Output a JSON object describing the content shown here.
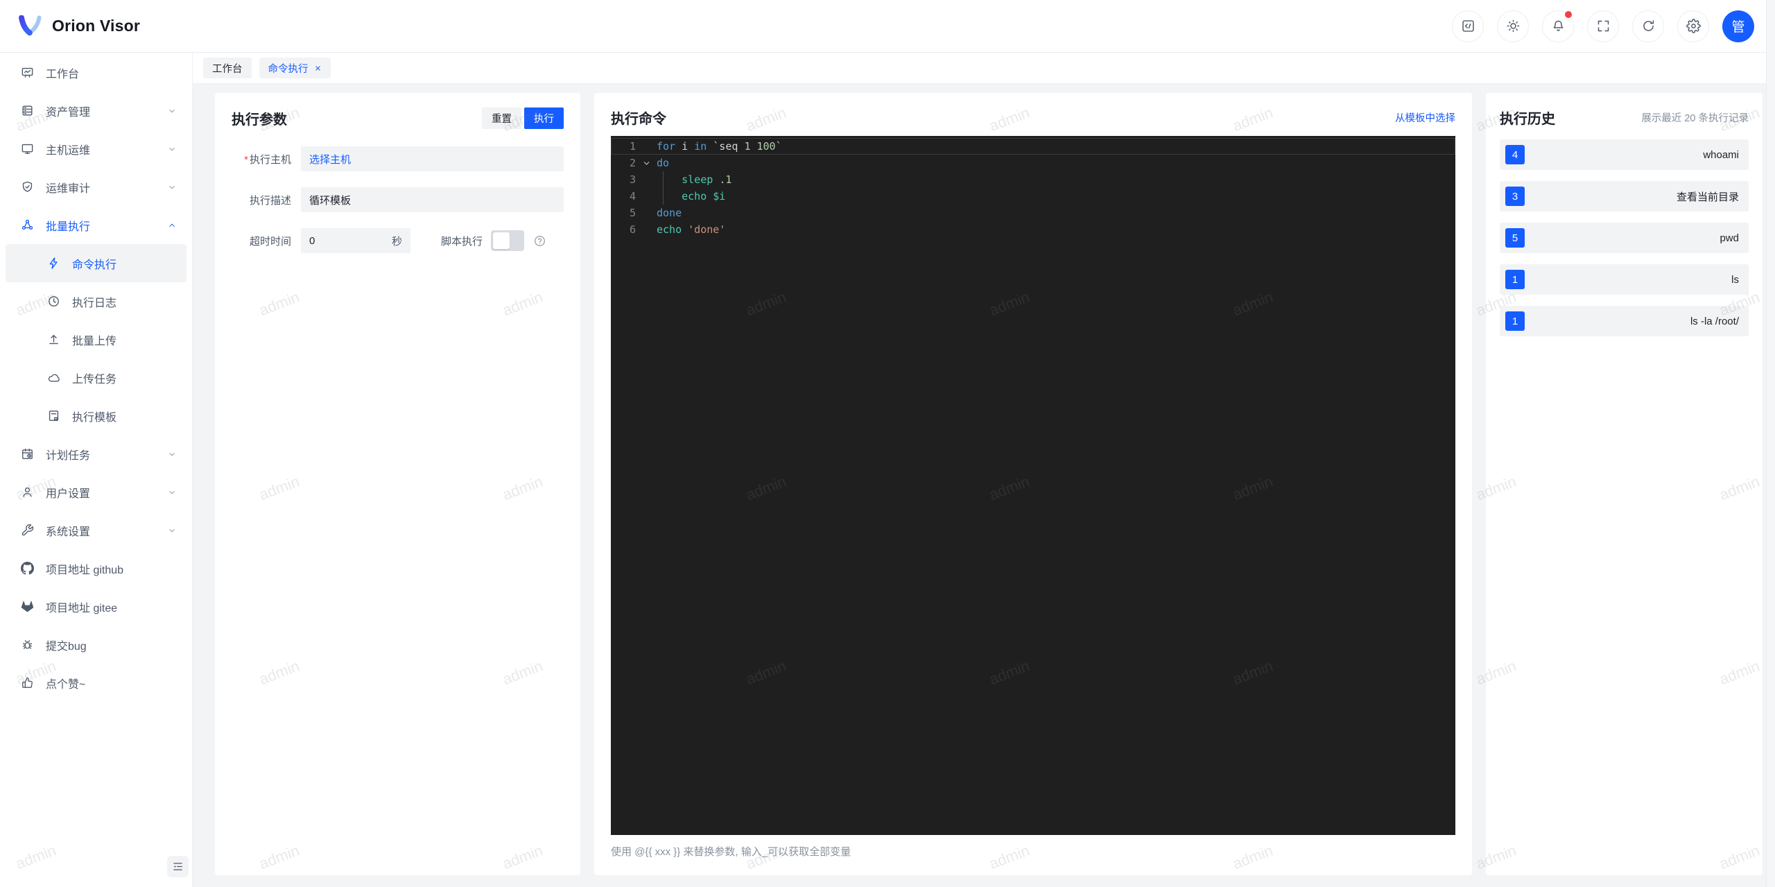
{
  "brand": {
    "name": "Orion Visor"
  },
  "topbar": {
    "buttons": [
      {
        "id": "console",
        "icon": "code"
      },
      {
        "id": "theme",
        "icon": "sun"
      },
      {
        "id": "notifications",
        "icon": "bell",
        "badge": true
      },
      {
        "id": "fullscreen",
        "icon": "expand"
      },
      {
        "id": "refresh",
        "icon": "refresh"
      },
      {
        "id": "settings",
        "icon": "gear"
      }
    ],
    "avatar_text": "管"
  },
  "sidebar": {
    "items": [
      {
        "id": "workbench",
        "icon": "workbench",
        "label": "工作台",
        "level": 1
      },
      {
        "id": "asset-management",
        "icon": "server",
        "label": "资产管理",
        "level": 1,
        "chevron": "down"
      },
      {
        "id": "host-ops",
        "icon": "monitor",
        "label": "主机运维",
        "level": 1,
        "chevron": "down"
      },
      {
        "id": "ops-audit",
        "icon": "shield",
        "label": "运维审计",
        "level": 1,
        "chevron": "down"
      },
      {
        "id": "batch-exec",
        "icon": "cluster",
        "label": "批量执行",
        "level": 1,
        "chevron": "up",
        "active": true
      },
      {
        "id": "command-exec",
        "icon": "bolt",
        "label": "命令执行",
        "level": 2,
        "selected": true
      },
      {
        "id": "exec-log",
        "icon": "history",
        "label": "执行日志",
        "level": 2
      },
      {
        "id": "batch-upload",
        "icon": "upload",
        "label": "批量上传",
        "level": 2
      },
      {
        "id": "upload-task",
        "icon": "cloud",
        "label": "上传任务",
        "level": 2
      },
      {
        "id": "exec-template",
        "icon": "template",
        "label": "执行模板",
        "level": 2
      },
      {
        "id": "scheduled-task",
        "icon": "calendar",
        "label": "计划任务",
        "level": 1,
        "chevron": "down"
      },
      {
        "id": "user-settings",
        "icon": "user",
        "label": "用户设置",
        "level": 1,
        "chevron": "down"
      },
      {
        "id": "system-settings",
        "icon": "wrench",
        "label": "系统设置",
        "level": 1,
        "chevron": "down"
      },
      {
        "id": "github",
        "icon": "github",
        "label": "项目地址 github",
        "level": 1
      },
      {
        "id": "gitee",
        "icon": "gitee",
        "label": "项目地址 gitee",
        "level": 1
      },
      {
        "id": "bug",
        "icon": "bug",
        "label": "提交bug",
        "level": 1
      },
      {
        "id": "like",
        "icon": "thumb",
        "label": "点个赞~",
        "level": 1
      }
    ]
  },
  "tabs": [
    {
      "id": "workbench",
      "label": "工作台"
    },
    {
      "id": "command-exec",
      "label": "命令执行",
      "active": true,
      "closable": true
    }
  ],
  "params_panel": {
    "title": "执行参数",
    "required_mark": "*",
    "reset_label": "重置",
    "execute_label": "执行",
    "fields": {
      "host": {
        "label": "执行主机",
        "value": "选择主机",
        "required": true
      },
      "description": {
        "label": "执行描述",
        "value": "循环模板"
      },
      "timeout": {
        "label": "超时时间",
        "value": "0",
        "unit": "秒"
      },
      "script": {
        "label": "脚本执行",
        "enabled": false
      }
    }
  },
  "command_panel": {
    "title": "执行命令",
    "template_link": "从模板中选择",
    "hint": "使用 @{{ xxx }} 来替换参数, 输入_可以获取全部变量",
    "editor": {
      "lines": [
        {
          "num": 1,
          "active": true,
          "tokens": [
            [
              "for",
              "kw"
            ],
            [
              " i ",
              "d"
            ],
            [
              "in",
              "kw"
            ],
            [
              " `seq ",
              "d"
            ],
            [
              "1",
              "num"
            ],
            [
              " ",
              "d"
            ],
            [
              "100",
              "num"
            ],
            [
              "`",
              "d"
            ]
          ]
        },
        {
          "num": 2,
          "fold": true,
          "tokens": [
            [
              "do",
              "kw"
            ]
          ]
        },
        {
          "num": 3,
          "guide": true,
          "tokens": [
            [
              "    ",
              "d"
            ],
            [
              "sleep",
              "fn"
            ],
            [
              " ",
              "d"
            ],
            [
              ".1",
              "num"
            ]
          ]
        },
        {
          "num": 4,
          "guide": true,
          "tokens": [
            [
              "    ",
              "d"
            ],
            [
              "echo",
              "fn"
            ],
            [
              " ",
              "d"
            ],
            [
              "$i",
              "var"
            ]
          ]
        },
        {
          "num": 5,
          "tokens": [
            [
              "done",
              "kw"
            ]
          ]
        },
        {
          "num": 6,
          "tokens": [
            [
              "echo",
              "fn"
            ],
            [
              " ",
              "d"
            ],
            [
              "'done'",
              "str"
            ]
          ]
        }
      ]
    }
  },
  "history_panel": {
    "title": "执行历史",
    "subtitle": "展示最近 20 条执行记录",
    "items": [
      {
        "count": "4",
        "command": "whoami"
      },
      {
        "count": "3",
        "command": "查看当前目录"
      },
      {
        "count": "5",
        "command": "pwd"
      },
      {
        "count": "1",
        "command": "ls"
      },
      {
        "count": "1",
        "command": "ls -la /root/"
      }
    ]
  },
  "watermark": {
    "text": "admin"
  },
  "colors": {
    "accent": "#165DFF",
    "danger": "#F53F3F",
    "editor_bg": "#1F1F1F",
    "token_keyword": "#569CD6",
    "token_builtin": "#4EC9B0",
    "token_number": "#B5CEA8",
    "token_string": "#CE9178",
    "token_default": "#D4D4D4",
    "badge_bg": "#165DFF"
  }
}
